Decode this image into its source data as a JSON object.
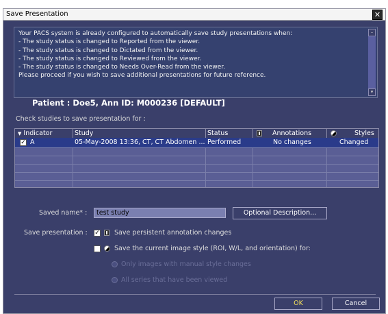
{
  "window": {
    "title": "Save Presentation",
    "close_glyph": "✕"
  },
  "message": {
    "lines": [
      "Your PACS system is already configured to automatically save study presentations when:",
      "- The study status is changed to Reported from the viewer.",
      "- The study status is changed to Dictated from the viewer.",
      "- The study status is changed to Reviewed from the viewer.",
      "- The study status is changed to Needs Over-Read from the viewer.",
      "Please proceed if you wish to save additional presentations for future reference."
    ]
  },
  "patient": {
    "text": "Patient : Doe5, Ann ID: M000236 [DEFAULT]"
  },
  "check_label": "Check studies to save presentation for :",
  "grid": {
    "columns": [
      "Indicator",
      "Study",
      "Status",
      "Annotations",
      "Styles"
    ],
    "rows": [
      {
        "indicator": "A",
        "checked": true,
        "study": "05-May-2008 13:36, CT, CT Abdomen ...",
        "status": "Performed",
        "annotations": "No changes",
        "styles": "Changed"
      }
    ]
  },
  "form": {
    "saved_name_label": "Saved name* :",
    "saved_name_value": "test study",
    "optional_description_button": "Optional Description...",
    "save_presentation_label": "Save presentation :",
    "save_annotation_label": "Save persistent annotation changes",
    "save_annotation_checked": true,
    "save_style_label": "Save the current image style (ROI, W/L, and orientation) for:",
    "save_style_checked": false,
    "radio_manual_label": "Only images with manual style changes",
    "radio_all_label": "All series that have been viewed"
  },
  "buttons": {
    "ok": "OK",
    "cancel": "Cancel"
  },
  "icons": {
    "close": "close-icon",
    "annotation": "annotation-icon",
    "style": "style-icon",
    "sort": "sort-down-icon",
    "cursor": "mouse-cursor-icon"
  },
  "colors": {
    "window_bg": "#3a3f6a",
    "grid_bg": "#5a5e95",
    "selected_row": "#2a3b8a",
    "ok_text": "#f4e05a",
    "cursor": "#ffd800"
  }
}
